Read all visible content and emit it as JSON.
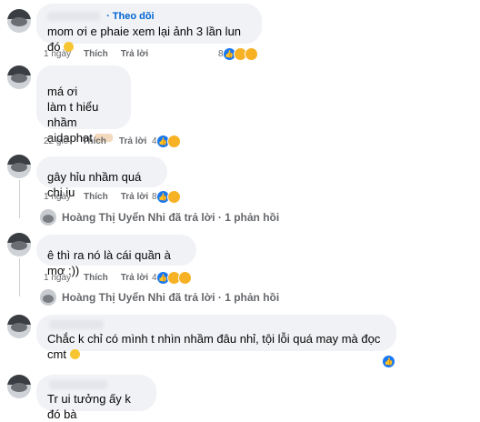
{
  "follow_label": "· Theo dõi",
  "comments": [
    {
      "text": "mom ơi e phaie xem lại ảnh 3 lần lun đó",
      "time": "1 ngày",
      "like": "Thích",
      "reply": "Trả lời",
      "react_count": "8"
    },
    {
      "lines": [
        "má ơi",
        "làm t hiểu nhầm",
        "aidaphat"
      ],
      "time": "22 giờ",
      "like": "Thích",
      "reply": "Trả lời",
      "react_count": "4"
    },
    {
      "text": "gây hỉu nhầm quá chị iu",
      "time": "1 ngày",
      "like": "Thích",
      "reply": "Trả lời",
      "react_count": "8",
      "reply_summary": "Hoàng Thị Uyển Nhi đã trả lời · 1 phản hồi"
    },
    {
      "text": "ê thì ra nó là cái quần à mợ :))",
      "time": "1 ngày",
      "like": "Thích",
      "reply": "Trả lời",
      "react_count": "4",
      "reply_summary": "Hoàng Thị Uyển Nhi đã trả lời · 1 phản hồi"
    },
    {
      "text": "Chắc k chỉ có mình t nhìn nhầm đâu nhỉ, tội lỗi quá may mà đọc cmt"
    },
    {
      "text": "Tr ui tưởng ấy k đó bà"
    }
  ],
  "colors": {
    "link": "#0064d1",
    "like": "#1877f2",
    "bubble": "#f0f2f5",
    "meta": "#65676b"
  },
  "icons": [
    "like-icon",
    "haha-icon",
    "care-icon",
    "sad-icon",
    "smile-emoji-icon",
    "hands-emoji-icon"
  ]
}
